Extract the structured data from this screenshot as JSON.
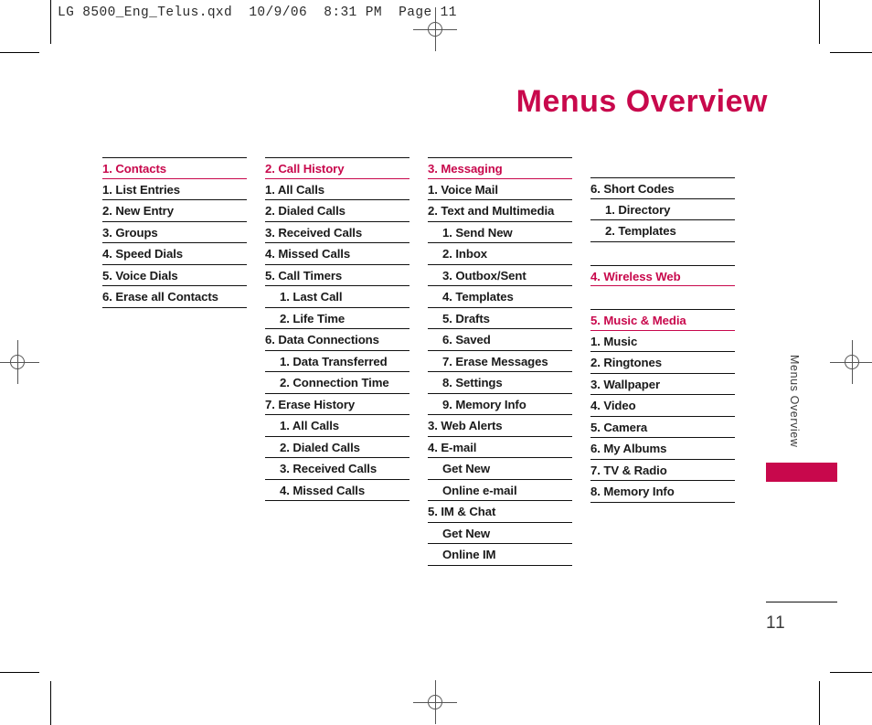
{
  "document": {
    "file_info": "LG 8500_Eng_Telus.qxd  10/9/06  8:31 PM  Page 11",
    "title": "Menus Overview",
    "side_label": "Menus Overview",
    "page_number": "11"
  },
  "colors": {
    "accent": "#c8084c",
    "text": "#1a1a1a",
    "rule": "#111111"
  },
  "columns": [
    {
      "groups": [
        {
          "header": "1. Contacts",
          "items": [
            {
              "label": "1. List Entries",
              "level": 1
            },
            {
              "label": "2. New Entry",
              "level": 1
            },
            {
              "label": "3. Groups",
              "level": 1
            },
            {
              "label": "4. Speed Dials",
              "level": 1
            },
            {
              "label": "5. Voice Dials",
              "level": 1
            },
            {
              "label": "6. Erase all Contacts",
              "level": 1
            }
          ]
        }
      ]
    },
    {
      "groups": [
        {
          "header": "2. Call History",
          "items": [
            {
              "label": "1. All Calls",
              "level": 1
            },
            {
              "label": "2. Dialed Calls",
              "level": 1
            },
            {
              "label": "3. Received Calls",
              "level": 1
            },
            {
              "label": "4. Missed Calls",
              "level": 1
            },
            {
              "label": "5. Call Timers",
              "level": 1
            },
            {
              "label": "1. Last Call",
              "level": 2
            },
            {
              "label": "2. Life Time",
              "level": 2
            },
            {
              "label": "6. Data Connections",
              "level": 1
            },
            {
              "label": "1. Data Transferred",
              "level": 2
            },
            {
              "label": "2. Connection Time",
              "level": 2
            },
            {
              "label": "7. Erase History",
              "level": 1
            },
            {
              "label": "1. All Calls",
              "level": 2
            },
            {
              "label": "2. Dialed Calls",
              "level": 2
            },
            {
              "label": "3. Received Calls",
              "level": 2
            },
            {
              "label": "4. Missed Calls",
              "level": 2
            }
          ]
        }
      ]
    },
    {
      "groups": [
        {
          "header": "3. Messaging",
          "items": [
            {
              "label": "1. Voice Mail",
              "level": 1
            },
            {
              "label": "2. Text and Multimedia",
              "level": 1
            },
            {
              "label": "1. Send New",
              "level": 2
            },
            {
              "label": "2. Inbox",
              "level": 2
            },
            {
              "label": "3. Outbox/Sent",
              "level": 2
            },
            {
              "label": "4. Templates",
              "level": 2
            },
            {
              "label": "5. Drafts",
              "level": 2
            },
            {
              "label": "6. Saved",
              "level": 2
            },
            {
              "label": "7. Erase Messages",
              "level": 2
            },
            {
              "label": "8. Settings",
              "level": 2
            },
            {
              "label": "9. Memory Info",
              "level": 2
            },
            {
              "label": "3. Web Alerts",
              "level": 1
            },
            {
              "label": "4. E-mail",
              "level": 1
            },
            {
              "label": "Get New",
              "level": 2
            },
            {
              "label": "Online e-mail",
              "level": 2
            },
            {
              "label": "5. IM & Chat",
              "level": 1
            },
            {
              "label": "Get New",
              "level": 2
            },
            {
              "label": "Online IM",
              "level": 2
            }
          ]
        }
      ]
    },
    {
      "groups": [
        {
          "header": null,
          "items": [
            {
              "label": "6. Short Codes",
              "level": 1
            },
            {
              "label": "1. Directory",
              "level": 2
            },
            {
              "label": "2. Templates",
              "level": 2
            }
          ]
        },
        {
          "header": "4. Wireless Web",
          "items": []
        },
        {
          "header": "5. Music & Media",
          "items": [
            {
              "label": "1. Music",
              "level": 1
            },
            {
              "label": "2. Ringtones",
              "level": 1
            },
            {
              "label": "3. Wallpaper",
              "level": 1
            },
            {
              "label": "4. Video",
              "level": 1
            },
            {
              "label": "5. Camera",
              "level": 1
            },
            {
              "label": "6. My Albums",
              "level": 1
            },
            {
              "label": "7. TV & Radio",
              "level": 1
            },
            {
              "label": "8. Memory Info",
              "level": 1
            }
          ]
        }
      ]
    }
  ]
}
